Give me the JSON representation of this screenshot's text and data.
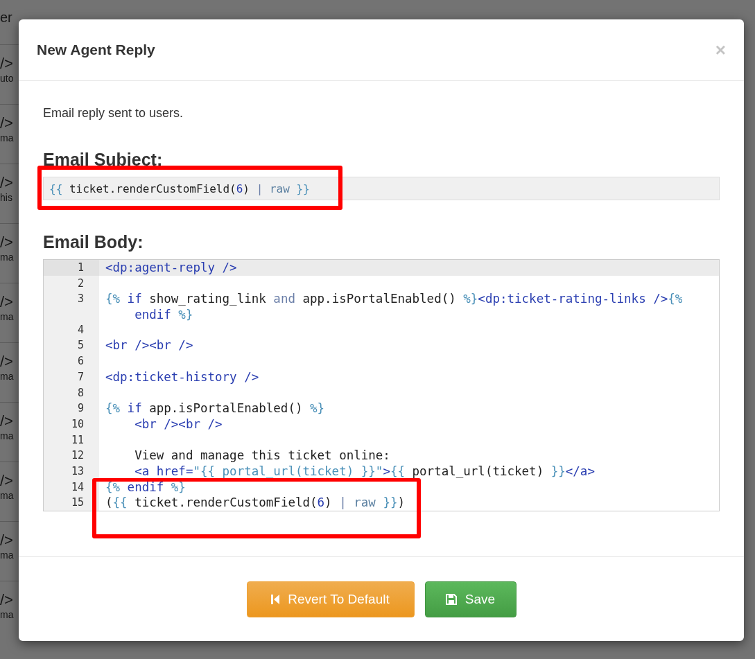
{
  "background": {
    "header": "er",
    "rows": [
      {
        "code": "/>",
        "note": "uto"
      },
      {
        "code": "/>",
        "note": "ma"
      },
      {
        "code": "/>",
        "note": "his"
      },
      {
        "code": "/>",
        "note": "ma"
      },
      {
        "code": "/>",
        "note": "ma"
      },
      {
        "code": "/>",
        "note": "ma"
      },
      {
        "code": "/>",
        "note": "ma"
      },
      {
        "code": "/>",
        "note": "ma"
      },
      {
        "code": "/>",
        "note": "ma"
      },
      {
        "code": "/>",
        "note": "ma"
      }
    ]
  },
  "dialog": {
    "title": "New Agent Reply",
    "close": "×",
    "description": "Email reply sent to users.",
    "subject_label": "Email Subject:",
    "subject_tokens": [
      {
        "text": "{{",
        "kind": "delim"
      },
      {
        "text": " ticket.renderCustomField(",
        "kind": "plain"
      },
      {
        "text": "6",
        "kind": "number"
      },
      {
        "text": ") ",
        "kind": "plain"
      },
      {
        "text": "|",
        "kind": "op"
      },
      {
        "text": " raw",
        "kind": "filter"
      },
      {
        "text": " }}",
        "kind": "delim"
      }
    ],
    "body_label": "Email Body:",
    "lines": [
      {
        "number": "1",
        "active": true,
        "indented": false,
        "tokens": [
          {
            "text": "<dp:agent-reply />",
            "kind": "tag"
          }
        ]
      },
      {
        "number": "2",
        "active": false
      },
      {
        "number": "3",
        "active": false,
        "indented": false,
        "tokens": [
          {
            "text": "{%",
            "kind": "delim"
          },
          {
            "text": " if",
            "kind": "keyword"
          },
          {
            "text": " show_rating_link ",
            "kind": "plain"
          },
          {
            "text": "and",
            "kind": "op"
          },
          {
            "text": " app.isPortalEnabled() ",
            "kind": "plain"
          },
          {
            "text": "%}",
            "kind": "delim"
          },
          {
            "text": "<dp:ticket-rating-links />",
            "kind": "tag"
          },
          {
            "text": "{%",
            "kind": "delim"
          },
          {
            "text": " endif",
            "kind": "keyword"
          },
          {
            "text": " %}",
            "kind": "delim"
          }
        ]
      },
      {
        "number": "4",
        "active": false
      },
      {
        "number": "5",
        "active": false,
        "indented": false,
        "tokens": [
          {
            "text": "<br /><br />",
            "kind": "tag"
          }
        ]
      },
      {
        "number": "6",
        "active": false
      },
      {
        "number": "7",
        "active": false,
        "indented": false,
        "tokens": [
          {
            "text": "<dp:ticket-history />",
            "kind": "tag"
          }
        ]
      },
      {
        "number": "8",
        "active": false
      },
      {
        "number": "9",
        "active": false,
        "indented": false,
        "tokens": [
          {
            "text": "{%",
            "kind": "delim"
          },
          {
            "text": " if",
            "kind": "keyword"
          },
          {
            "text": " app.isPortalEnabled() ",
            "kind": "plain"
          },
          {
            "text": "%}",
            "kind": "delim"
          }
        ]
      },
      {
        "number": "10",
        "active": false,
        "indented": true,
        "tokens": [
          {
            "text": "<br /><br />",
            "kind": "tag"
          }
        ]
      },
      {
        "number": "11",
        "active": false
      },
      {
        "number": "12",
        "active": false,
        "indented": true,
        "tokens": [
          {
            "text": "View and manage this ticket online:",
            "kind": "plain"
          }
        ]
      },
      {
        "number": "13",
        "active": false,
        "indented": true,
        "tokens": [
          {
            "text": "<a href=",
            "kind": "tag"
          },
          {
            "text": "\"{{ portal_url(ticket) }}\"",
            "kind": "string"
          },
          {
            "text": ">",
            "kind": "tag"
          },
          {
            "text": "{{",
            "kind": "delim"
          },
          {
            "text": " portal_url(ticket) ",
            "kind": "plain"
          },
          {
            "text": "}}",
            "kind": "delim"
          },
          {
            "text": "</a>",
            "kind": "tag"
          }
        ]
      },
      {
        "number": "14",
        "active": false,
        "indented": false,
        "tokens": [
          {
            "text": "{%",
            "kind": "delim"
          },
          {
            "text": " endif",
            "kind": "keyword"
          },
          {
            "text": " %}",
            "kind": "delim"
          }
        ]
      },
      {
        "number": "15",
        "active": false,
        "indented": false,
        "tokens": [
          {
            "text": "(",
            "kind": "plain"
          },
          {
            "text": "{{",
            "kind": "delim"
          },
          {
            "text": " ticket.renderCustomField(",
            "kind": "plain"
          },
          {
            "text": "6",
            "kind": "number"
          },
          {
            "text": ") ",
            "kind": "plain"
          },
          {
            "text": "|",
            "kind": "op"
          },
          {
            "text": " raw",
            "kind": "filter"
          },
          {
            "text": " }}",
            "kind": "delim"
          },
          {
            "text": ")",
            "kind": "plain"
          }
        ]
      }
    ],
    "buttons": [
      {
        "label": "Revert To Default",
        "kind": "revert"
      },
      {
        "label": "Save",
        "kind": "save"
      }
    ]
  }
}
